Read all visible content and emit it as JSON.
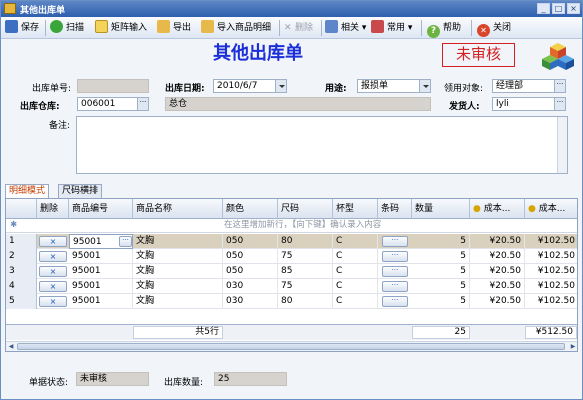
{
  "window": {
    "title": "其他出库单",
    "min_label": "_",
    "max_label": "□",
    "close_label": "×"
  },
  "toolbar": {
    "save": "保存",
    "scan": "扫描",
    "matrix_input": "矩阵输入",
    "export": "导出",
    "import_details": "导入商品明细",
    "delete": "删除",
    "related": "相关",
    "common": "常用",
    "help": "帮助",
    "close": "关闭"
  },
  "header": {
    "title": "其他出库单",
    "status_stamp": "未审核"
  },
  "form": {
    "doc_no_label": "出库单号:",
    "doc_no_value": "",
    "date_label": "出库日期:",
    "date_value": "2010/6/7",
    "purpose_label": "用途:",
    "purpose_value": "报损单",
    "recipient_label": "领用对象:",
    "recipient_value": "经理部",
    "warehouse_label": "出库仓库:",
    "warehouse_code": "006001",
    "warehouse_name": "总仓",
    "sender_label": "发货人:",
    "sender_value": "lyli",
    "remark_label": "备注:",
    "remark_value": ""
  },
  "tabs": [
    {
      "label": "明细模式",
      "active": true
    },
    {
      "label": "尺码横排",
      "active": false
    }
  ],
  "grid": {
    "columns": [
      "删除",
      "商品编号",
      "商品名称",
      "颜色",
      "尺码",
      "杯型",
      "条码",
      "数量",
      "成本...",
      "成本..."
    ],
    "new_row_hint": "在这里增加新行，【向下键】确认录入内容",
    "delete_glyph": "×",
    "ellipsis": "···",
    "rows": [
      {
        "idx": "1",
        "code": "95001",
        "name": "文胸",
        "color": "050",
        "size": "80",
        "cup": "C",
        "qty": "5",
        "cost1": "¥20.50",
        "cost2": "¥102.50",
        "selected": true
      },
      {
        "idx": "2",
        "code": "95001",
        "name": "文胸",
        "color": "050",
        "size": "75",
        "cup": "C",
        "qty": "5",
        "cost1": "¥20.50",
        "cost2": "¥102.50",
        "selected": false
      },
      {
        "idx": "3",
        "code": "95001",
        "name": "文胸",
        "color": "050",
        "size": "85",
        "cup": "C",
        "qty": "5",
        "cost1": "¥20.50",
        "cost2": "¥102.50",
        "selected": false
      },
      {
        "idx": "4",
        "code": "95001",
        "name": "文胸",
        "color": "030",
        "size": "75",
        "cup": "C",
        "qty": "5",
        "cost1": "¥20.50",
        "cost2": "¥102.50",
        "selected": false
      },
      {
        "idx": "5",
        "code": "95001",
        "name": "文胸",
        "color": "030",
        "size": "80",
        "cup": "C",
        "qty": "5",
        "cost1": "¥20.50",
        "cost2": "¥102.50",
        "selected": false
      }
    ],
    "footer": {
      "row_count": "共5行",
      "total_qty": "25",
      "total_cost": "¥512.50"
    }
  },
  "status": {
    "doc_state_label": "单据状态:",
    "doc_state_value": "未审核",
    "qty_label": "出库数量:",
    "qty_value": "25"
  },
  "colors": {
    "title_blue": "#1b2fd9",
    "stamp_red": "#d42020",
    "selected_row": "#d9d1bd"
  }
}
